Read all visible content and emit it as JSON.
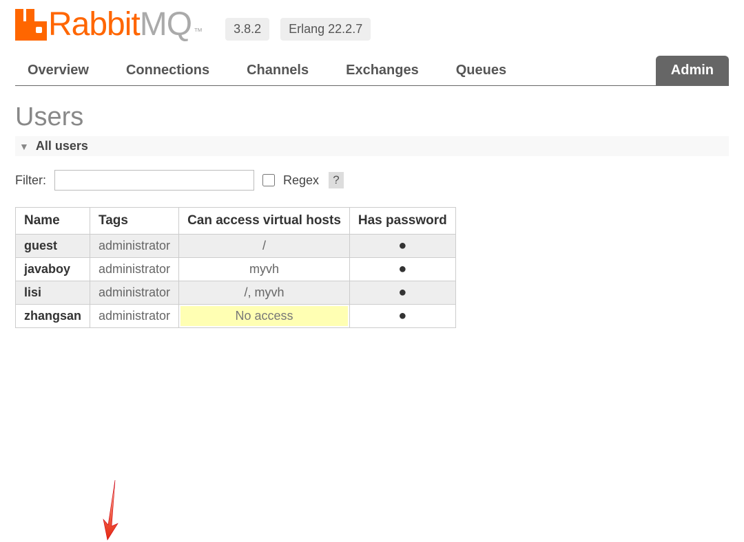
{
  "logo": {
    "rabbit": "Rabbit",
    "mq": "MQ",
    "tm": "™"
  },
  "versions": {
    "rabbit": "3.8.2",
    "erlang": "Erlang 22.2.7"
  },
  "tabs": {
    "overview": "Overview",
    "connections": "Connections",
    "channels": "Channels",
    "exchanges": "Exchanges",
    "queues": "Queues",
    "admin": "Admin"
  },
  "page": {
    "title": "Users",
    "expander": "All users"
  },
  "filter": {
    "label": "Filter:",
    "value": "",
    "regex_label": "Regex",
    "help": "?"
  },
  "table": {
    "headers": {
      "name": "Name",
      "tags": "Tags",
      "vhosts": "Can access virtual hosts",
      "password": "Has password"
    },
    "rows": [
      {
        "name": "guest",
        "tags": "administrator",
        "vhosts": "/",
        "password": "●",
        "alt": true,
        "no_access": false
      },
      {
        "name": "javaboy",
        "tags": "administrator",
        "vhosts": "myvh",
        "password": "●",
        "alt": false,
        "no_access": false
      },
      {
        "name": "lisi",
        "tags": "administrator",
        "vhosts": "/, myvh",
        "password": "●",
        "alt": true,
        "no_access": false
      },
      {
        "name": "zhangsan",
        "tags": "administrator",
        "vhosts": "No access",
        "password": "●",
        "alt": false,
        "no_access": true
      }
    ]
  }
}
